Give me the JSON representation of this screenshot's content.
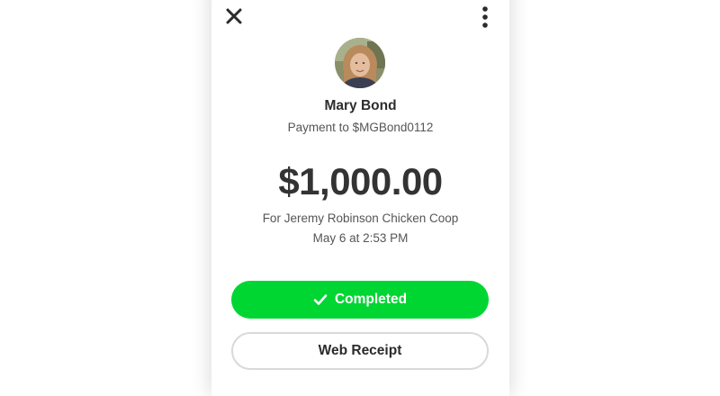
{
  "payment": {
    "recipient_name": "Mary Bond",
    "payment_to": "Payment to $MGBond0112",
    "amount": "$1,000.00",
    "memo": "For Jeremy Robinson Chicken Coop",
    "timestamp": "May 6 at 2:53 PM"
  },
  "actions": {
    "status_label": "Completed",
    "receipt_label": "Web Receipt"
  },
  "icons": {
    "close": "close-icon",
    "more": "more-vertical-icon",
    "check": "check-icon"
  },
  "colors": {
    "accent_green": "#00d632",
    "text_dark": "#2b2b2b",
    "text_muted": "#555555",
    "button_border": "#d9d9d9"
  }
}
